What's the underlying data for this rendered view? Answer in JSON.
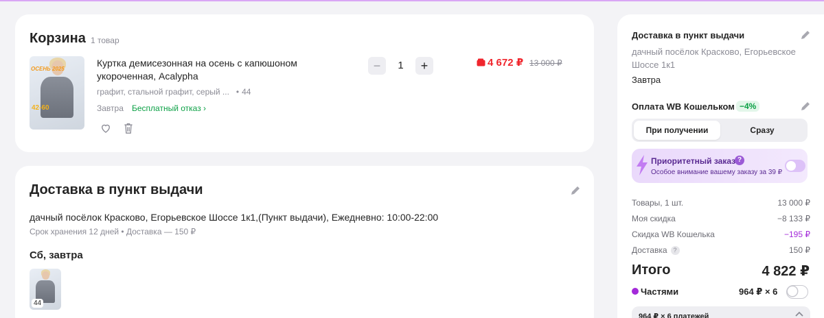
{
  "cart": {
    "title": "Корзина",
    "count": "1 товар",
    "item": {
      "thumb_promo_top": "ОСЕНЬ 2025",
      "thumb_promo_bottom": "42-60",
      "name": "Куртка демисезонная на осень с капюшоном укороченная, Acalypha",
      "color": "графит, стальной графит, серый ...",
      "size": "44",
      "delivery_when": "Завтра",
      "free_return": "Бесплатный отказ ›",
      "quantity": "1",
      "qty_minus": "−",
      "qty_plus": "+",
      "price_now": "4 672 ₽",
      "price_old": "13 000 ₽",
      "price_color": "#f0262d"
    }
  },
  "delivery": {
    "title": "Доставка в пункт выдачи",
    "address": "дачный посёлок Красково, Егорьевское Шоссе 1к1,(Пункт выдачи), Ежедневно: 10:00-22:00",
    "info": "Срок хранения 12 дней • Доставка — 150 ₽",
    "date": "Сб, завтра",
    "thumb_size": "44"
  },
  "sidebar": {
    "delivery_title": "Доставка в пункт выдачи",
    "address": "дачный посёлок Красково, Егорьевское Шоссе 1к1",
    "when": "Завтра",
    "payment_title": "Оплата WB Кошельком",
    "payment_discount": "−4%",
    "segments": [
      "При получении",
      "Сразу"
    ],
    "priority": {
      "title": "Приоритетный заказ",
      "help": "?",
      "subtitle": "Особое внимание вашему заказу за 39 ₽"
    },
    "summary": [
      {
        "label": "Товары, 1 шт.",
        "value": "13 000 ₽"
      },
      {
        "label": "Моя скидка",
        "value": "−8 133 ₽"
      },
      {
        "label": "Скидка WB Кошелька",
        "value": "−195 ₽"
      },
      {
        "label": "Доставка",
        "value": "150 ₽"
      }
    ],
    "total_label": "Итого",
    "total_value": "4 822 ₽",
    "parts_label": "Частями",
    "parts_amount": "964 ₽ × 6",
    "plan_text": "964 ₽ × 6 платежей",
    "accent_color": "#a32ad9",
    "green_color": "#0ba045"
  }
}
